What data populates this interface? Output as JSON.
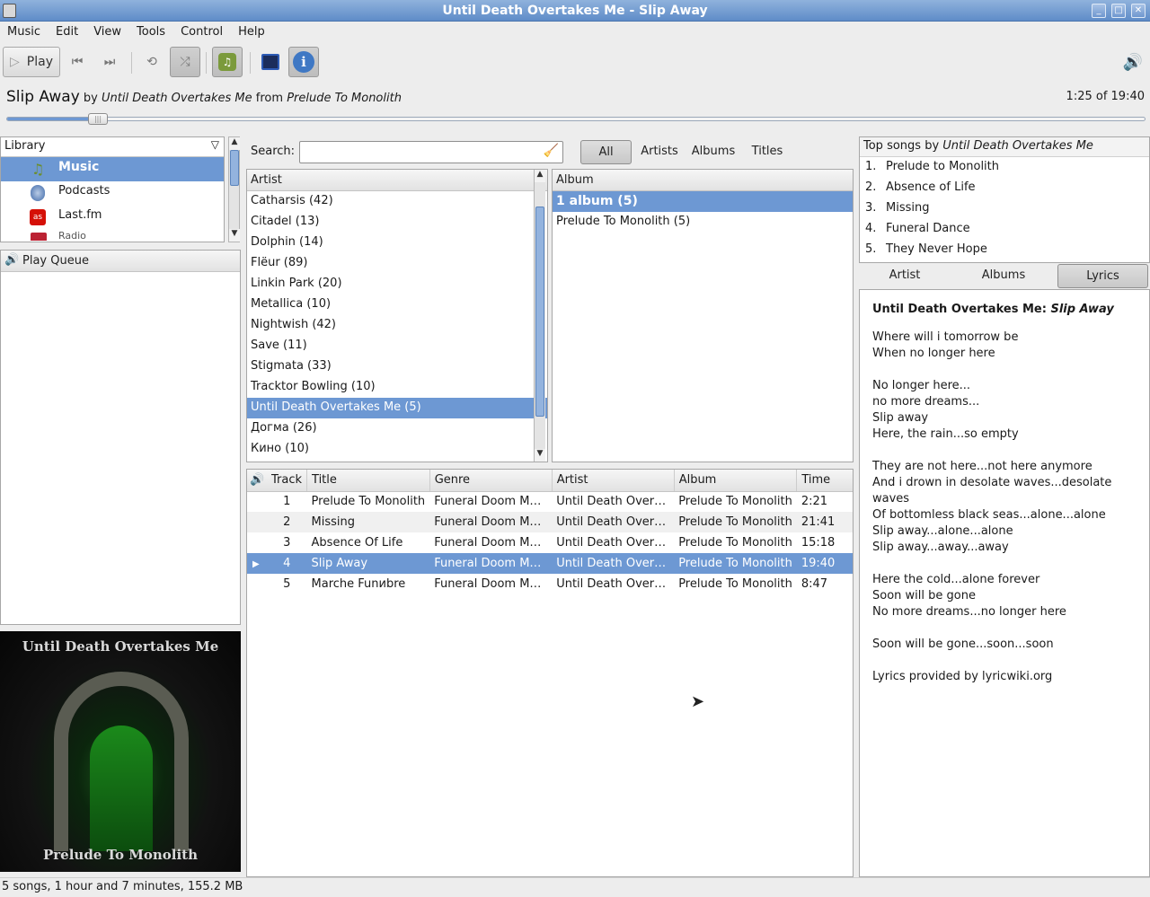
{
  "window": {
    "title": "Until Death Overtakes Me - Slip Away"
  },
  "menu": [
    "Music",
    "Edit",
    "View",
    "Tools",
    "Control",
    "Help"
  ],
  "toolbar": {
    "play_label": "Play",
    "icons": [
      "play-icon",
      "previous-icon",
      "next-icon",
      "repeat-icon",
      "shuffle-icon",
      "playlist-icon",
      "visualizer-icon",
      "info-icon",
      "volume-icon"
    ]
  },
  "now_playing": {
    "song": "Slip Away",
    "by": "by",
    "artist": "Until Death Overtakes Me",
    "from": "from",
    "album": "Prelude To Monolith",
    "position": "1:25 of 19:40",
    "progress_fraction": 0.072
  },
  "sources": {
    "header": "Library",
    "items": [
      "Music",
      "Podcasts",
      "Last.fm",
      "Radio"
    ]
  },
  "queue": {
    "title": "Play Queue"
  },
  "search": {
    "label": "Search:",
    "value": ""
  },
  "filters": {
    "all": "All",
    "artists": "Artists",
    "albums": "Albums",
    "titles": "Titles"
  },
  "artist_browser": {
    "header": "Artist",
    "items": [
      "Catharsis (42)",
      "Citadel (13)",
      "Dolphin (14)",
      "Flëur (89)",
      "Linkin Park (20)",
      "Metallica (10)",
      "Nightwish (42)",
      "Save (11)",
      "Stigmata (33)",
      "Tracktor Bowling (10)",
      "Until Death Overtakes Me (5)",
      "Догма (26)",
      "Кино (10)"
    ],
    "selected": 10
  },
  "album_browser": {
    "header": "Album",
    "items": [
      "1 album (5)",
      "Prelude To Monolith (5)"
    ]
  },
  "tracks": {
    "columns": [
      "Track",
      "Title",
      "Genre",
      "Artist",
      "Album",
      "Time"
    ],
    "rows": [
      [
        "1",
        "Prelude To Monolith",
        "Funeral Doom ME...",
        "Until Death Overt...",
        "Prelude To Monolith",
        "2:21"
      ],
      [
        "2",
        "Missing",
        "Funeral Doom ME...",
        "Until Death Overt...",
        "Prelude To Monolith",
        "21:41"
      ],
      [
        "3",
        "Absence Of Life",
        "Funeral Doom ME...",
        "Until Death Overt...",
        "Prelude To Monolith",
        "15:18"
      ],
      [
        "4",
        "Slip Away",
        "Funeral Doom ME...",
        "Until Death Overt...",
        "Prelude To Monolith",
        "19:40"
      ],
      [
        "5",
        "Marche Funиbre",
        "Funeral Doom ME...",
        "Until Death Overt...",
        "Prelude To Monolith",
        "8:47"
      ]
    ],
    "playing": 3
  },
  "cover": {
    "band": "Until Death Overtakes Me",
    "album": "Prelude To Monolith"
  },
  "top_songs": {
    "prefix": "Top songs by",
    "artist": "Until Death Overtakes Me",
    "items": [
      "Prelude to Monolith",
      "Absence of Life",
      "Missing",
      "Funeral Dance",
      "They Never Hope"
    ]
  },
  "context_tabs": {
    "artist": "Artist",
    "albums": "Albums",
    "lyrics": "Lyrics"
  },
  "lyrics": {
    "artist": "Until Death Overtakes Me:",
    "title": "Slip Away",
    "lines": [
      "Where will i tomorrow be",
      "When no longer here",
      "",
      "No longer here...",
      "no more dreams...",
      "Slip away",
      "Here, the rain...so empty",
      "",
      "They are not here...not here anymore",
      "And i drown in desolate waves...desolate",
      "waves",
      "Of bottomless black seas...alone...alone",
      "Slip away...alone...alone",
      "Slip away...away...away",
      "",
      "Here the cold...alone forever",
      "Soon will be gone",
      "No more dreams...no longer here",
      "",
      "Soon will be gone...soon...soon",
      "",
      "Lyrics provided by lyricwiki.org"
    ]
  },
  "status": "5 songs, 1 hour and 7 minutes, 155.2 MB",
  "colors": {
    "selection": "#6d98d3",
    "titlebar": "#6f97cf"
  }
}
